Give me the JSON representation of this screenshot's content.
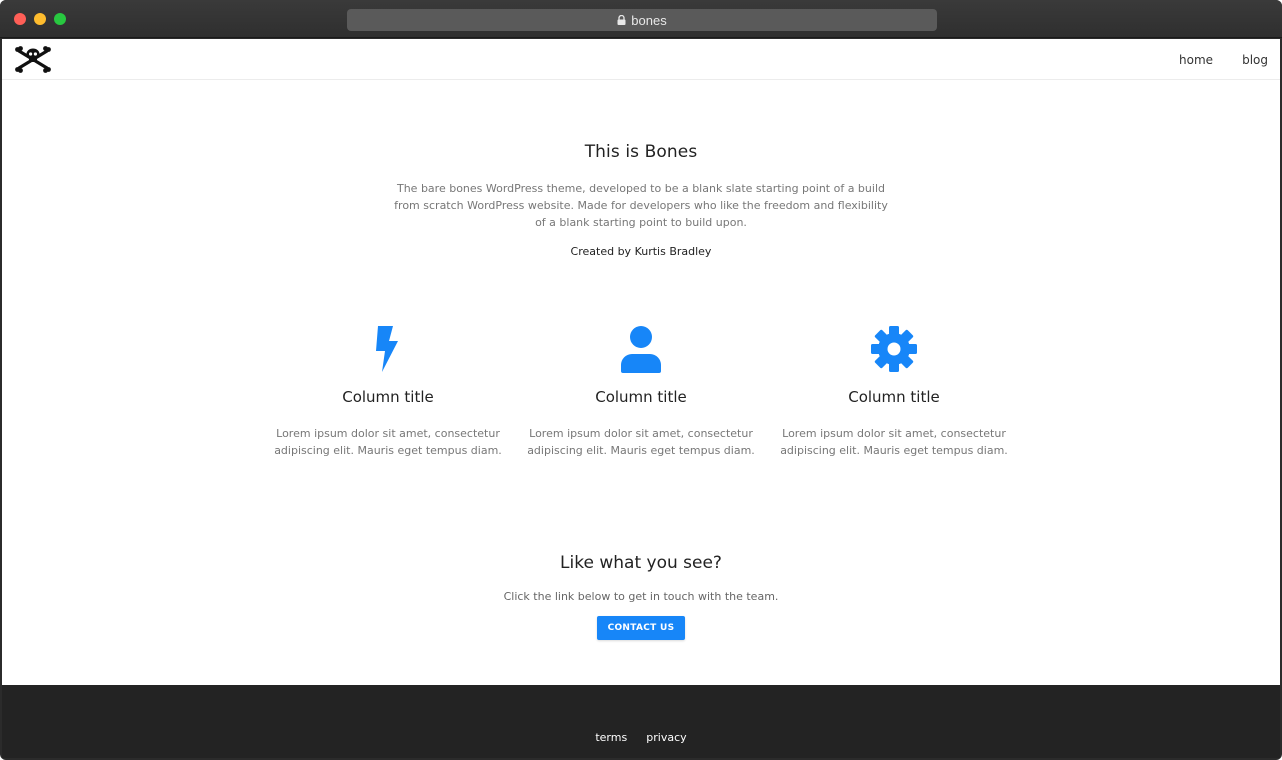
{
  "browser": {
    "url": "bones",
    "lock_icon": "lock-icon"
  },
  "header": {
    "logo": "skull-crossbones-icon",
    "nav": [
      {
        "label": "home"
      },
      {
        "label": "blog"
      }
    ]
  },
  "hero": {
    "title": "This is Bones",
    "description": "The bare bones WordPress theme, developed to be a blank slate starting point of a build from scratch WordPress website. Made for developers who like the freedom and flexibility of a blank starting point to build upon.",
    "credit": "Created by Kurtis Bradley"
  },
  "columns": [
    {
      "icon": "lightning-bolt-icon",
      "title": "Column title",
      "text": "Lorem ipsum dolor sit amet, consectetur adipiscing elit. Mauris eget tempus diam."
    },
    {
      "icon": "user-icon",
      "title": "Column title",
      "text": "Lorem ipsum dolor sit amet, consectetur adipiscing elit. Mauris eget tempus diam."
    },
    {
      "icon": "gear-icon",
      "title": "Column title",
      "text": "Lorem ipsum dolor sit amet, consectetur adipiscing elit. Mauris eget tempus diam."
    }
  ],
  "cta": {
    "title": "Like what you see?",
    "text": "Click the link below to get in touch with the team.",
    "button": "CONTACT US"
  },
  "footer": {
    "links": [
      {
        "label": "terms"
      },
      {
        "label": "privacy"
      }
    ]
  },
  "colors": {
    "accent": "#1786f8",
    "footer_bg": "#232323"
  }
}
